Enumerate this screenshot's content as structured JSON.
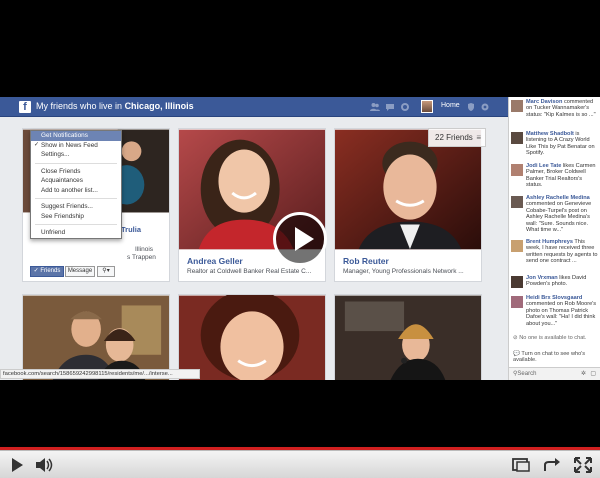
{
  "topbar": {
    "title_prefix": "My friends who live in",
    "title_place": "Chicago, Illinois",
    "home": "Home",
    "logo": "f"
  },
  "friends_badge": "22 Friends",
  "dropdown": {
    "items": [
      "Get Notifications",
      "Show in News Feed",
      "Settings...",
      "Close Friends",
      "Acquaintances",
      "Add to another list...",
      "Suggest Friends...",
      "See Friendship",
      "Unfriend"
    ]
  },
  "card1": {
    "partial_name": "Trulia",
    "partial_line1": "Illinois",
    "partial_line2": "s Trappen",
    "friends_btn": "Friends",
    "message_btn": "Message"
  },
  "card2": {
    "name": "Andrea Geller",
    "subtitle": "Realtor at Coldwell Banker Real Estate C..."
  },
  "card3": {
    "name": "Rob Reuter",
    "subtitle": "Manager, Young Professionals Network ..."
  },
  "ticker": [
    {
      "name": "Marc Davison",
      "text": "commented on Tucker Wannamaker's status: \"Kip Kalmes is so ...\""
    },
    {
      "name": "Matthew Shadbolt",
      "text": "is listening to A Crazy World Like This by Pat Benatar on Spotify."
    },
    {
      "name": "Jodi Lee Tate",
      "text": "likes Carmen Palmer, Broker Coldwell Banker Trial Realtors's status."
    },
    {
      "name": "Ashley Rachelle Medina",
      "text": "commented on Genevieve Cobabe-Turpel's post on Ashley Rachelle Medina's wall: \"Sure. Sounds nice. What time w...\""
    },
    {
      "name": "Brent Humphreys",
      "text": "This week, I have received three written requests by agents to send one contract ..."
    },
    {
      "name": "Jon Vrxman",
      "text": "likes David Powden's photo."
    },
    {
      "name": "Heidi Brx Slovsgaard",
      "text": "commented on Rob Moore's photo on Thomas Patrick Dafoe's wall: \"Ha! I did think about you...\""
    }
  ],
  "chat": {
    "offline": "No one is available to chat.",
    "turn_on": "Turn on chat to see who's available.",
    "search": "Search"
  },
  "status_url": "facebook.com/search/158659242998115/residents/me/.../interse...",
  "colors": {
    "facebook_blue": "#3b5998",
    "progress_red": "#d01f1f"
  }
}
